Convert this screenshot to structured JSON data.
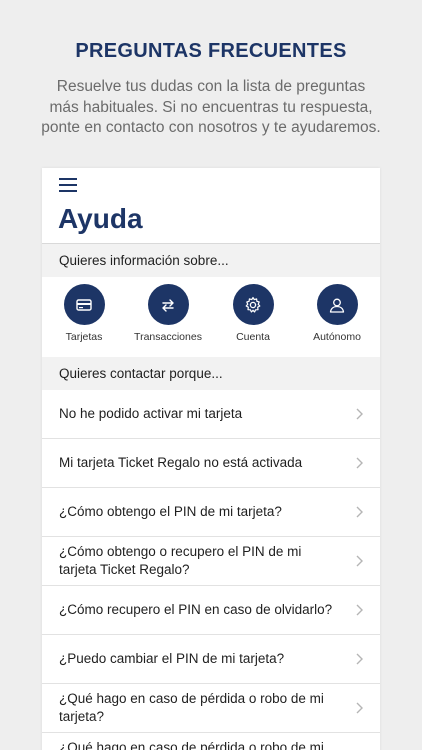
{
  "promo": {
    "title": "PREGUNTAS FRECUENTES",
    "subtitle_lines": [
      "Resuelve tus dudas con la lista de preguntas",
      "más habituales. Si no encuentras tu respuesta,",
      "ponte en contacto con nosotros y te ayudaremos."
    ]
  },
  "app": {
    "title": "Ayuda",
    "info_section": "Quieres información sobre...",
    "contact_section": "Quieres contactar porque...",
    "categories": [
      {
        "label": "Tarjetas",
        "icon": "card-icon"
      },
      {
        "label": "Transacciones",
        "icon": "transfer-icon"
      },
      {
        "label": "Cuenta",
        "icon": "gear-icon"
      },
      {
        "label": "Autónomo",
        "icon": "user-icon"
      }
    ],
    "faq": [
      "No he podido activar mi tarjeta",
      "Mi tarjeta Ticket Regalo no está activada",
      "¿Cómo obtengo el PIN de mi tarjeta?",
      "¿Cómo obtengo o recupero el PIN de mi tarjeta Ticket Regalo?",
      "¿Cómo recupero el PIN en caso de olvidarlo?",
      "¿Puedo cambiar el PIN de mi tarjeta?",
      "¿Qué hago en caso de pérdida o robo de mi tarjeta?",
      "¿Qué hago en caso de pérdida o robo de mi"
    ]
  },
  "colors": {
    "accent": "#1d3566",
    "background": "#eeeeee",
    "section_bg": "#f2f2f2"
  }
}
